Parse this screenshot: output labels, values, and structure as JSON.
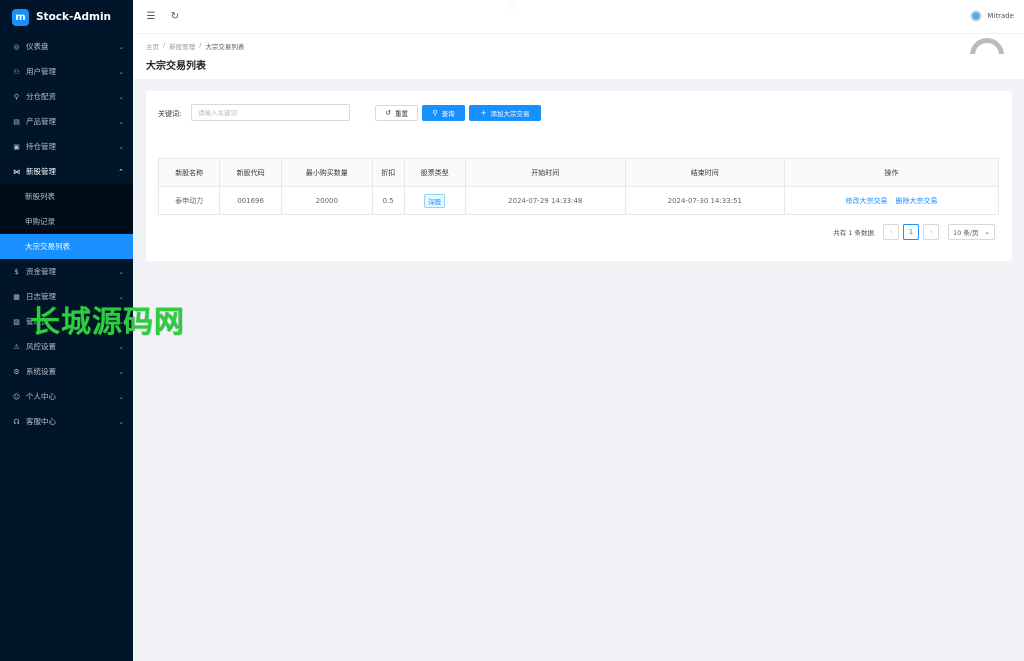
{
  "brand": {
    "title": "Stock-Admin",
    "logo_letter": "m"
  },
  "sidebar": {
    "items": [
      {
        "label": "仪表盘",
        "icon": "◎",
        "icon_name": "dashboard-icon"
      },
      {
        "label": "用户管理",
        "icon": "⚇",
        "icon_name": "user-manage-icon"
      },
      {
        "label": "分仓配资",
        "icon": "⚲",
        "icon_name": "allocation-icon"
      },
      {
        "label": "产品管理",
        "icon": "▤",
        "icon_name": "product-icon"
      },
      {
        "label": "持仓管理",
        "icon": "▣",
        "icon_name": "position-icon"
      },
      {
        "label": "新股管理",
        "icon": "⋈",
        "icon_name": "ipo-icon",
        "open": true,
        "children": [
          {
            "label": "新股列表"
          },
          {
            "label": "申购记录"
          },
          {
            "label": "大宗交易列表",
            "active": true
          }
        ]
      },
      {
        "label": "资金管理",
        "icon": "$",
        "icon_name": "fund-icon"
      },
      {
        "label": "日志管理",
        "icon": "▦",
        "icon_name": "log-icon"
      },
      {
        "label": "管理员",
        "icon": "▧",
        "icon_name": "admin-icon"
      },
      {
        "label": "风控设置",
        "icon": "⚠",
        "icon_name": "risk-icon"
      },
      {
        "label": "系统设置",
        "icon": "⚙",
        "icon_name": "settings-icon"
      },
      {
        "label": "个人中心",
        "icon": "☺",
        "icon_name": "profile-icon"
      },
      {
        "label": "客服中心",
        "icon": "☊",
        "icon_name": "support-icon"
      }
    ]
  },
  "header": {
    "user_name": "Mitrade",
    "menu_toggle_icon": "☰",
    "refresh_icon": "↻"
  },
  "breadcrumb": [
    "主页",
    "新股管理",
    "大宗交易列表"
  ],
  "page": {
    "title": "大宗交易列表"
  },
  "search": {
    "label": "关键词:",
    "placeholder": "请输入关键词",
    "value": "",
    "reset_label": "重置",
    "query_label": "查询",
    "add_label": "添加大宗交易"
  },
  "table": {
    "columns": [
      "新股名称",
      "新股代码",
      "最小购买数量",
      "折扣",
      "股票类型",
      "开始时间",
      "结束时间",
      "操作"
    ],
    "rows": [
      {
        "name": "泰申动力",
        "code": "001696",
        "min_qty": "20000",
        "discount": "0.5",
        "type": "深股",
        "start": "2024-07-29 14:33:48",
        "end": "2024-07-30 14:33:51",
        "edit_label": "修改大宗交易",
        "delete_label": "删除大宗交易"
      }
    ]
  },
  "pagination": {
    "total_text": "共有 1 条数据",
    "current": "1",
    "page_size": "10 条/页"
  },
  "watermark": "长城源码网",
  "colors": {
    "primary": "#1890ff",
    "sidebar_bg": "#001529",
    "watermark": "#2ecc40"
  }
}
